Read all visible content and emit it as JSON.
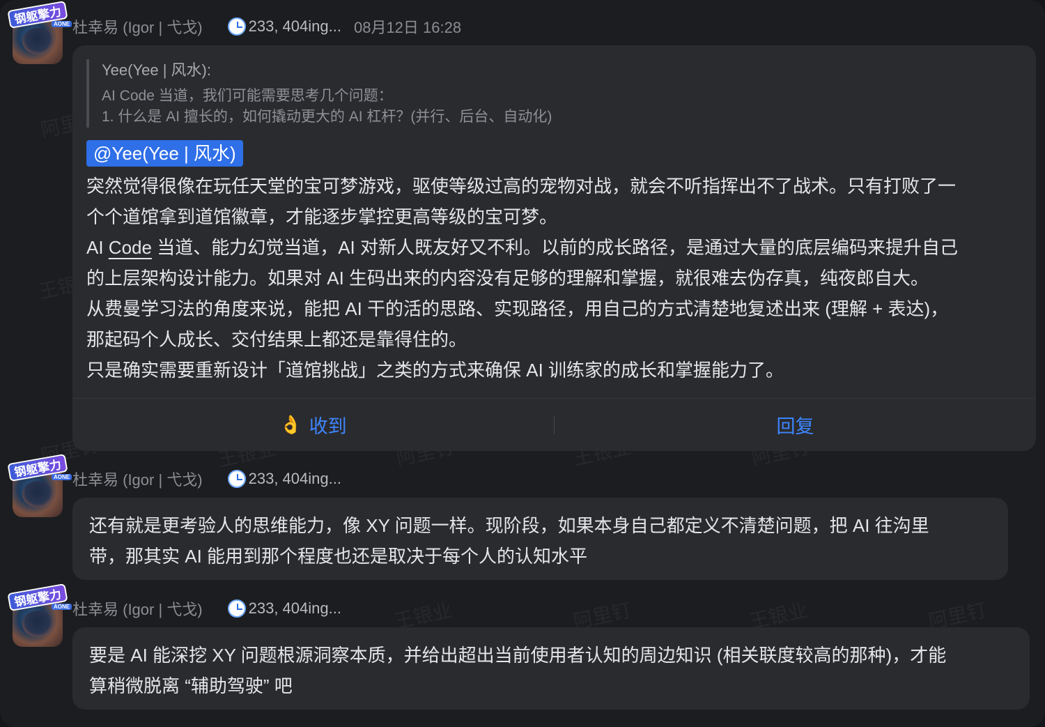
{
  "watermarks": [
    "阿里",
    "王银",
    "阿里钉",
    "王银业",
    "阿里钉",
    "王银业",
    "阿里钉",
    "王银业",
    "阿里钉",
    "王银业",
    "阿里钉"
  ],
  "avatar": {
    "badge": "钢躯擎力",
    "sub": "AONE"
  },
  "messages": [
    {
      "author": "杜幸易 (Igor | 弋戈)",
      "status": "233, 404ing...",
      "time": "08月12日 16:28",
      "quote": {
        "author": "Yee(Yee | 风水):",
        "lines": [
          "AI Code 当道，我们可能需要思考几个问题：",
          "1. 什么是 AI 擅长的，如何撬动更大的 AI 杠杆？(并行、后台、自动化)"
        ]
      },
      "mention": "@Yee(Yee | 风水)",
      "lines": [
        "突然觉得很像在玩任天堂的宝可梦游戏，驱使等级过高的宠物对战，就会不听指挥出不了战术。只有打败了一",
        "个个道馆拿到道馆徽章，才能逐步掌控更高等级的宝可梦。",
        "当道、能力幻觉当道，AI 对新人既友好又不利。以前的成长路径，是通过大量的底层编码来提升自己",
        "的上层架构设计能力。如果对 AI 生码出来的内容没有足够的理解和掌握，就很难去伪存真，纯夜郎自大。",
        "从费曼学习法的角度来说，能把 AI 干的活的思路、实现路径，用自己的方式清楚地复述出来 (理解 + 表达)，",
        "那起码个人成长、交付结果上都还是靠得住的。",
        "只是确实需要重新设计「道馆挑战」之类的方式来确保 AI 训练家的成长和掌握能力了。"
      ],
      "line3_prefix": "AI ",
      "line3_link": "Code",
      "actions": {
        "ack": "收到",
        "reply": "回复"
      }
    },
    {
      "author": "杜幸易 (Igor | 弋戈)",
      "status": "233, 404ing...",
      "lines": [
        "还有就是更考验人的思维能力，像 XY 问题一样。现阶段，如果本身自己都定义不清楚问题，把 AI 往沟里",
        "带，那其实 AI 能用到那个程度也还是取决于每个人的认知水平"
      ]
    },
    {
      "author": "杜幸易 (Igor | 弋戈)",
      "status": "233, 404ing...",
      "lines": [
        "要是 AI 能深挖 XY 问题根源洞察本质，并给出超出当前使用者认知的周边知识 (相关联度较高的那种)，才能",
        "算稍微脱离 “辅助驾驶” 吧"
      ]
    }
  ]
}
